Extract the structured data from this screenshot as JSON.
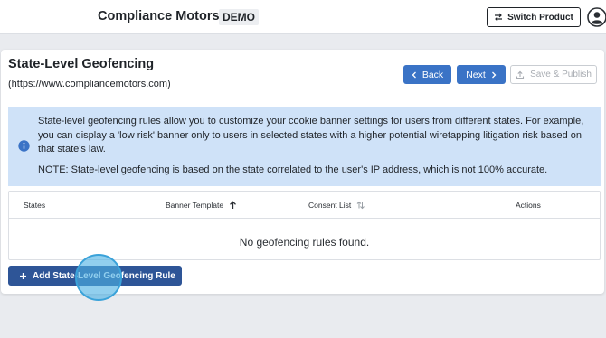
{
  "header": {
    "brand": "Compliance Motors",
    "badge": "DEMO",
    "switch_product_label": "Switch Product",
    "icons": {
      "switch": "switch-arrows-icon",
      "avatar": "user-avatar-icon"
    }
  },
  "page": {
    "title": "State-Level Geofencing",
    "url": "(https://www.compliancemotors.com)"
  },
  "actions": {
    "back_label": "Back",
    "next_label": "Next",
    "save_publish_label": "Save & Publish"
  },
  "info": {
    "text": "State-level geofencing rules allow you to customize your cookie banner settings for users from different states. For example, you can display a 'low risk' banner only to users in selected states with a higher potential wiretapping litigation risk based on that state's law.",
    "note": "NOTE: State-level geofencing is based on the state correlated to the user's IP address, which is not 100% accurate.",
    "icon": "info-icon"
  },
  "table": {
    "columns": [
      "States",
      "Banner Template",
      "Consent List",
      "Actions"
    ],
    "empty_message": "No geofencing rules found."
  },
  "add_rule_label": "Add State-Level Geofencing Rule",
  "colors": {
    "primary": "#3a73c6",
    "primary_dark": "#2e5597",
    "info_bg": "#cfe2f8",
    "page_bg": "#e9ebef"
  }
}
